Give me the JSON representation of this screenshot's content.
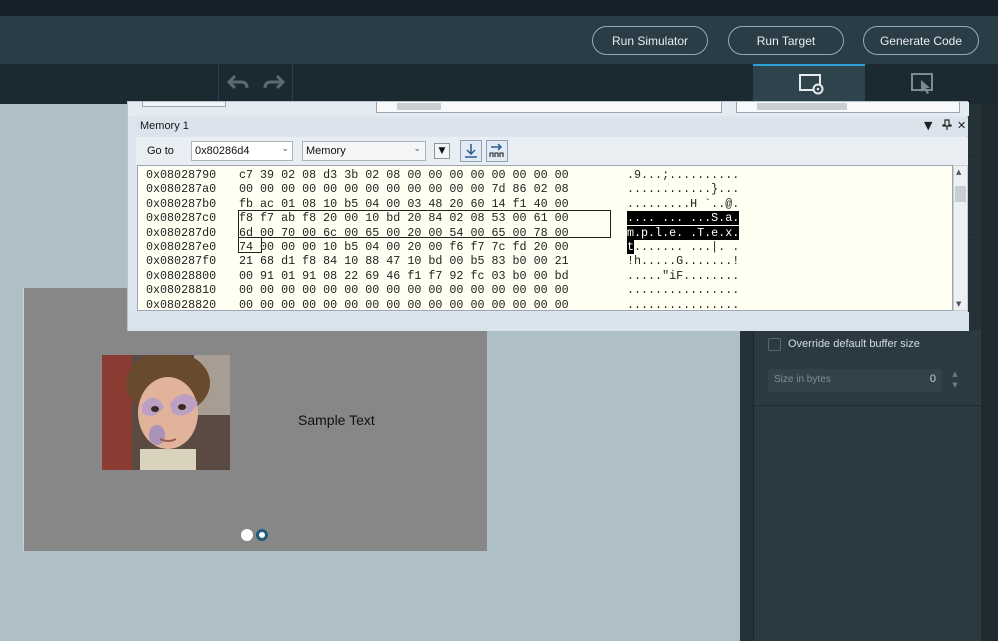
{
  "header": {
    "buttons": [
      "Run Simulator",
      "Run Target",
      "Generate Code"
    ]
  },
  "toolbar": {
    "undo_icon": "undo-arrow-icon",
    "redo_icon": "redo-arrow-icon",
    "tab_canvas_icon": "screen-gear-icon",
    "tab_interaction_icon": "screen-pointer-icon"
  },
  "right_panel": {
    "override_label": "Override default buffer size",
    "size_placeholder": "Size in bytes",
    "size_value": "0"
  },
  "canvas": {
    "sample_text": "Sample Text",
    "page_dots": 2,
    "active_dot": 1
  },
  "memory_window": {
    "title": "Memory 1",
    "goto_label": "Go to",
    "goto_value": "0x80286d4",
    "type_value": "Memory",
    "rows": [
      {
        "addr": "0x08028790",
        "bytes": "c7 39 02 08 d3 3b 02 08 00 00 00 00 00 00 00 00",
        "ascii": ".9...;.........."
      },
      {
        "addr": "0x080287a0",
        "bytes": "00 00 00 00 00 00 00 00 00 00 00 00 7d 86 02 08",
        "ascii": "............}..."
      },
      {
        "addr": "0x080287b0",
        "bytes": "fb ac 01 08 10 b5 04 00 03 48 20 60 14 f1 40 00",
        "ascii": ".........H `..@."
      },
      {
        "addr": "0x080287c0",
        "bytes": "f8 f7 ab f8 20 00 10 bd 20 84 02 08 53 00 61 00",
        "ascii": ".... ... ...S.a."
      },
      {
        "addr": "0x080287d0",
        "bytes": "6d 00 70 00 6c 00 65 00 20 00 54 00 65 00 78 00",
        "ascii": "m.p.l.e. .T.e.x."
      },
      {
        "addr": "0x080287e0",
        "bytes": "74 00 00 00 10 b5 04 00 20 00 f6 f7 7c fd 20 00",
        "ascii": "t....... ...|. ."
      },
      {
        "addr": "0x080287f0",
        "bytes": "21 68 d1 f8 84 10 88 47 10 bd 00 b5 83 b0 00 21",
        "ascii": "!h.....G.......!"
      },
      {
        "addr": "0x08028800",
        "bytes": "00 91 01 91 08 22 69 46 f1 f7 92 fc 03 b0 00 bd",
        "ascii": ".....\"iF........"
      },
      {
        "addr": "0x08028810",
        "bytes": "00 00 00 00 00 00 00 00 00 00 00 00 00 00 00 00",
        "ascii": "................"
      },
      {
        "addr": "0x08028820",
        "bytes": "00 00 00 00 00 00 00 00 00 00 00 00 00 00 00 00",
        "ascii": "................"
      }
    ]
  },
  "colors": {
    "accent": "#2a9fd8",
    "header_bg": "#2a3c45",
    "canvas_bg": "#aebfc7",
    "screen_bg": "#878787",
    "hex_bg": "#fffff2"
  }
}
